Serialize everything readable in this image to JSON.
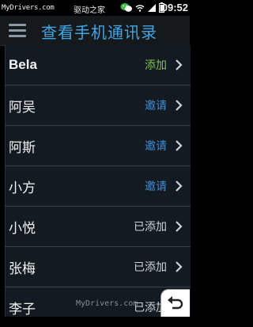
{
  "status_bar": {
    "brand": "MyDrivers.com",
    "brand_cn": "驱动之家",
    "time": "09:52",
    "icons": [
      "wechat-icon",
      "wifi-icon",
      "signal-icon",
      "battery-icon"
    ]
  },
  "header": {
    "title": "查看手机通讯录"
  },
  "contacts": [
    {
      "name": "Bela",
      "status": "添加",
      "status_type": "add"
    },
    {
      "name": "阿吴",
      "status": "邀请",
      "status_type": "invite"
    },
    {
      "name": "阿斯",
      "status": "邀请",
      "status_type": "invite"
    },
    {
      "name": "小方",
      "status": "邀请",
      "status_type": "invite"
    },
    {
      "name": "小悦",
      "status": "已添加",
      "status_type": "added"
    },
    {
      "name": "张梅",
      "status": "已添加",
      "status_type": "added"
    },
    {
      "name": "李子",
      "status": "已添加",
      "status_type": "added"
    }
  ],
  "watermark": "MyDrivers.com",
  "colors": {
    "accent": "#3fa7e8",
    "add": "#7fc24a",
    "invite": "#3f8fd8"
  }
}
